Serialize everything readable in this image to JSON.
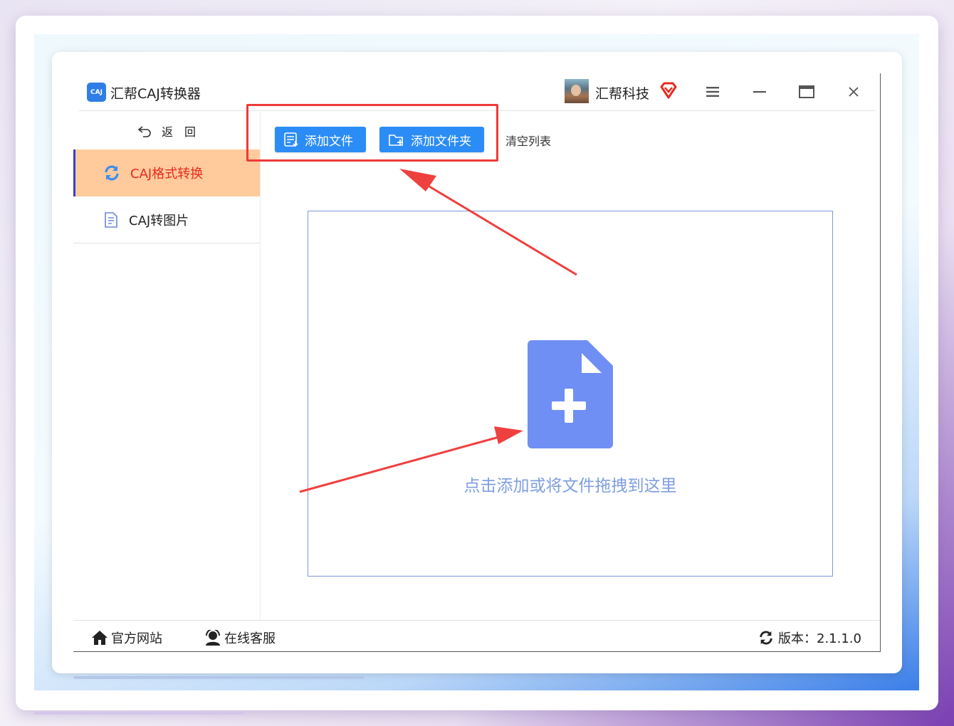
{
  "app": {
    "title": "汇帮CAJ转换器",
    "logo_text": "CAJ",
    "brand": "汇帮科技"
  },
  "window_controls": {
    "menu": "≡",
    "minimize": "—",
    "maximize": "□",
    "close": "✕"
  },
  "sidebar": {
    "back_label": "返　回",
    "items": [
      {
        "label": "CAJ格式转换",
        "icon": "refresh-icon",
        "active": true
      },
      {
        "label": "CAJ转图片",
        "icon": "document-icon",
        "active": false
      }
    ]
  },
  "toolbar": {
    "add_file": "添加文件",
    "add_folder": "添加文件夹",
    "clear_list": "清空列表"
  },
  "dropzone": {
    "hint": "点击添加或将文件拖拽到这里"
  },
  "footer": {
    "website": "官方网站",
    "service": "在线客服",
    "version": "版本：2.1.1.0"
  },
  "colors": {
    "accent_blue": "#2c8cf5",
    "active_bg": "#ffcb9c",
    "active_text": "#e8291c",
    "annotation_red": "#ef3a3a",
    "drop_icon": "#6f8ff5"
  }
}
